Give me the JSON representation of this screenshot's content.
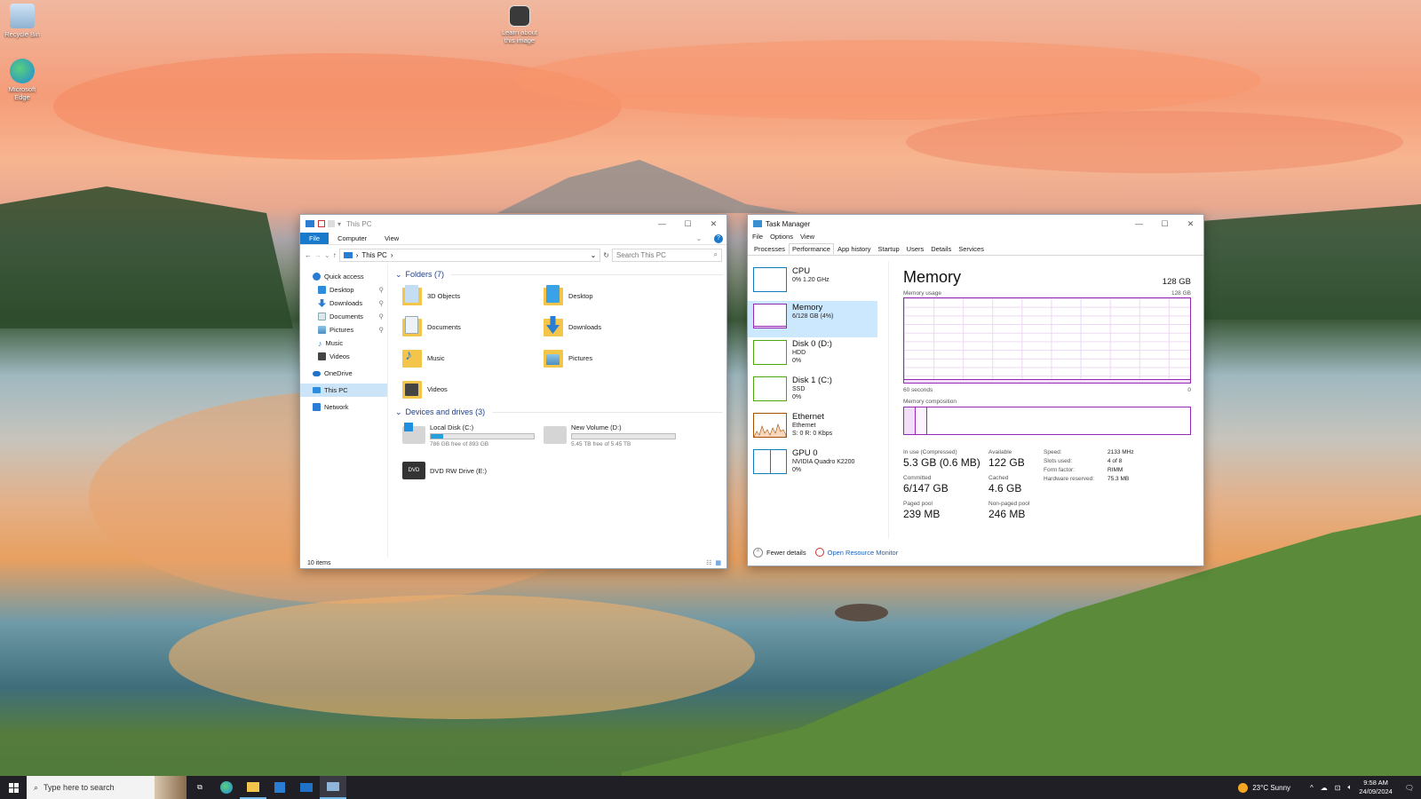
{
  "desktop": {
    "icons": [
      {
        "label": "Recycle Bin"
      },
      {
        "label": "Microsoft Edge"
      },
      {
        "label": "Learn about this image"
      }
    ]
  },
  "explorer": {
    "title": "This PC",
    "ribbon_tabs": [
      "File",
      "Computer",
      "View"
    ],
    "address": "This PC",
    "search_placeholder": "Search This PC",
    "nav": [
      {
        "label": "Quick access"
      },
      {
        "label": "Desktop"
      },
      {
        "label": "Downloads"
      },
      {
        "label": "Documents"
      },
      {
        "label": "Pictures"
      },
      {
        "label": "Music"
      },
      {
        "label": "Videos"
      },
      {
        "label": "OneDrive"
      },
      {
        "label": "This PC"
      },
      {
        "label": "Network"
      }
    ],
    "folders_header": "Folders (7)",
    "folders": [
      "3D Objects",
      "Desktop",
      "Documents",
      "Downloads",
      "Music",
      "Pictures",
      "Videos"
    ],
    "drives_header": "Devices and drives (3)",
    "drives": [
      {
        "name": "Local Disk (C:)",
        "free": "786 GB free of 893 GB",
        "used_fraction": 0.12
      },
      {
        "name": "New Volume (D:)",
        "free": "5.45 TB free of 5.45 TB",
        "used_fraction": 0.0
      },
      {
        "name": "DVD RW Drive (E:)"
      }
    ],
    "status": "10 items"
  },
  "taskmanager": {
    "title": "Task Manager",
    "menu": [
      "File",
      "Options",
      "View"
    ],
    "tabs": [
      "Processes",
      "Performance",
      "App history",
      "Startup",
      "Users",
      "Details",
      "Services"
    ],
    "active_tab": "Performance",
    "resources": [
      {
        "name": "CPU",
        "l1": "0% 1.20 GHz",
        "l2": ""
      },
      {
        "name": "Memory",
        "l1": "6/128 GB (4%)",
        "l2": ""
      },
      {
        "name": "Disk 0 (D:)",
        "l1": "HDD",
        "l2": "0%"
      },
      {
        "name": "Disk 1 (C:)",
        "l1": "SSD",
        "l2": "0%"
      },
      {
        "name": "Ethernet",
        "l1": "Ethernet",
        "l2": "S: 0 R: 0 Kbps"
      },
      {
        "name": "GPU 0",
        "l1": "NVIDIA Quadro K2200",
        "l2": "0%"
      }
    ],
    "memory": {
      "heading": "Memory",
      "capacity": "128 GB",
      "usage_label": "Memory usage",
      "usage_max": "128 GB",
      "time_left": "60 seconds",
      "time_right": "0",
      "composition_label": "Memory composition",
      "in_use_label": "In use (Compressed)",
      "in_use": "5.3 GB (0.6 MB)",
      "available_label": "Available",
      "available": "122 GB",
      "committed_label": "Committed",
      "committed": "6/147 GB",
      "cached_label": "Cached",
      "cached": "4.6 GB",
      "paged_label": "Paged pool",
      "paged": "239 MB",
      "nonpaged_label": "Non-paged pool",
      "nonpaged": "246 MB",
      "specs": [
        {
          "k": "Speed:",
          "v": "2133 MHz"
        },
        {
          "k": "Slots used:",
          "v": "4 of 8"
        },
        {
          "k": "Form factor:",
          "v": "RIMM"
        },
        {
          "k": "Hardware reserved:",
          "v": "75.3 MB"
        }
      ]
    },
    "fewer_details": "Fewer details",
    "open_monitor": "Open Resource Monitor"
  },
  "taskbar": {
    "search_placeholder": "Type here to search",
    "weather": "23°C  Sunny",
    "time": "9:58 AM",
    "date": "24/09/2024"
  },
  "colors": {
    "accent": "#1979ca",
    "memory": "#9528b4",
    "cpu": "#117dbb",
    "disk": "#4da60c",
    "ethernet": "#a74f01"
  }
}
